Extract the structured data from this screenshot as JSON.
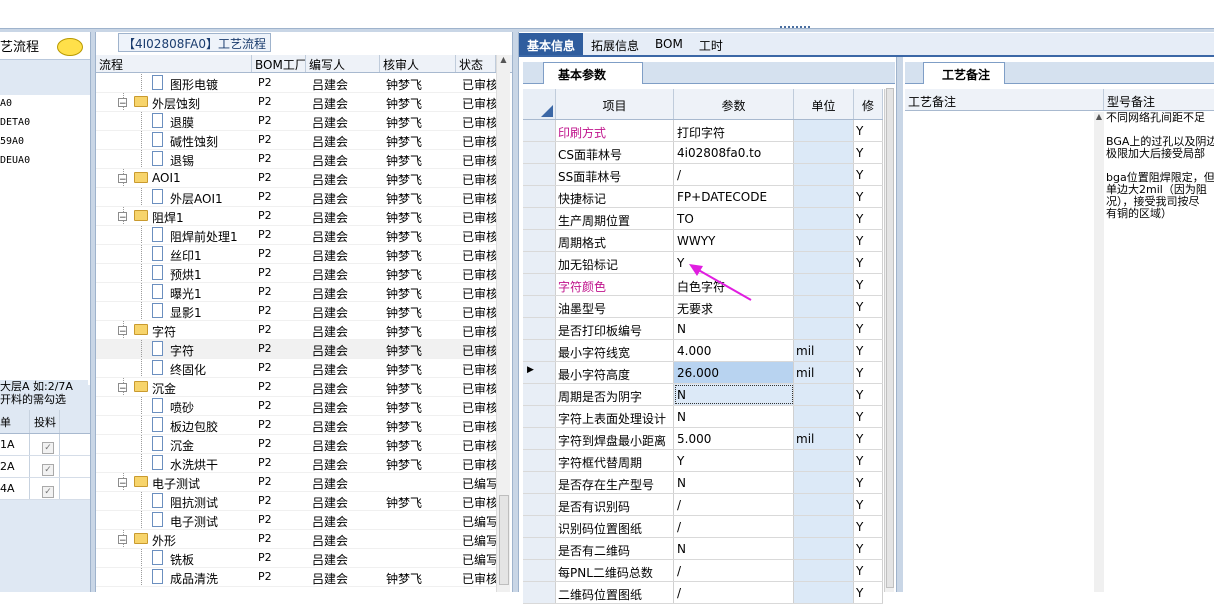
{
  "left_panel": {
    "title": "艺流程",
    "items": [
      "A0",
      "DETA0",
      "59A0",
      "DEUA0"
    ],
    "note_line1": "大层A 如:2/7A",
    "note_line2": "开料的需勾选",
    "grid_headers": [
      "单",
      "投料"
    ],
    "grid_rows": [
      {
        "name": "1A",
        "checked": true
      },
      {
        "name": "2A",
        "checked": true
      },
      {
        "name": "4A",
        "checked": true
      }
    ]
  },
  "middle": {
    "title": "【4I02808FA0】工艺流程",
    "headers": [
      "流程",
      "BOM工厂",
      "编写人",
      "核审人",
      "状态"
    ],
    "rows": [
      {
        "indent": 2,
        "type": "doc",
        "name": "图形电镀",
        "bom": "P2",
        "writer": "吕建会",
        "reviewer": "钟梦飞",
        "status": "已审核"
      },
      {
        "indent": 1,
        "type": "folder",
        "name": "外层蚀刻",
        "bom": "P2",
        "writer": "吕建会",
        "reviewer": "钟梦飞",
        "status": "已审核"
      },
      {
        "indent": 2,
        "type": "doc",
        "name": "退膜",
        "bom": "P2",
        "writer": "吕建会",
        "reviewer": "钟梦飞",
        "status": "已审核"
      },
      {
        "indent": 2,
        "type": "doc",
        "name": "碱性蚀刻",
        "bom": "P2",
        "writer": "吕建会",
        "reviewer": "钟梦飞",
        "status": "已审核"
      },
      {
        "indent": 2,
        "type": "doc",
        "name": "退锡",
        "bom": "P2",
        "writer": "吕建会",
        "reviewer": "钟梦飞",
        "status": "已审核"
      },
      {
        "indent": 1,
        "type": "folder",
        "name": "AOI1",
        "bom": "P2",
        "writer": "吕建会",
        "reviewer": "钟梦飞",
        "status": "已审核"
      },
      {
        "indent": 2,
        "type": "doc",
        "name": "外层AOI1",
        "bom": "P2",
        "writer": "吕建会",
        "reviewer": "钟梦飞",
        "status": "已审核"
      },
      {
        "indent": 1,
        "type": "folder",
        "name": "阻焊1",
        "bom": "P2",
        "writer": "吕建会",
        "reviewer": "钟梦飞",
        "status": "已审核"
      },
      {
        "indent": 2,
        "type": "doc",
        "name": "阻焊前处理1",
        "bom": "P2",
        "writer": "吕建会",
        "reviewer": "钟梦飞",
        "status": "已审核"
      },
      {
        "indent": 2,
        "type": "doc",
        "name": "丝印1",
        "bom": "P2",
        "writer": "吕建会",
        "reviewer": "钟梦飞",
        "status": "已审核"
      },
      {
        "indent": 2,
        "type": "doc",
        "name": "预烘1",
        "bom": "P2",
        "writer": "吕建会",
        "reviewer": "钟梦飞",
        "status": "已审核"
      },
      {
        "indent": 2,
        "type": "doc",
        "name": "曝光1",
        "bom": "P2",
        "writer": "吕建会",
        "reviewer": "钟梦飞",
        "status": "已审核"
      },
      {
        "indent": 2,
        "type": "doc",
        "name": "显影1",
        "bom": "P2",
        "writer": "吕建会",
        "reviewer": "钟梦飞",
        "status": "已审核"
      },
      {
        "indent": 1,
        "type": "folder",
        "name": "字符",
        "bom": "P2",
        "writer": "吕建会",
        "reviewer": "钟梦飞",
        "status": "已审核"
      },
      {
        "indent": 2,
        "type": "doc",
        "name": "字符",
        "bom": "P2",
        "writer": "吕建会",
        "reviewer": "钟梦飞",
        "status": "已审核",
        "selected": true
      },
      {
        "indent": 2,
        "type": "doc",
        "name": "终固化",
        "bom": "P2",
        "writer": "吕建会",
        "reviewer": "钟梦飞",
        "status": "已审核"
      },
      {
        "indent": 1,
        "type": "folder",
        "name": "沉金",
        "bom": "P2",
        "writer": "吕建会",
        "reviewer": "钟梦飞",
        "status": "已审核"
      },
      {
        "indent": 2,
        "type": "doc",
        "name": "喷砂",
        "bom": "P2",
        "writer": "吕建会",
        "reviewer": "钟梦飞",
        "status": "已审核"
      },
      {
        "indent": 2,
        "type": "doc",
        "name": "板边包胶",
        "bom": "P2",
        "writer": "吕建会",
        "reviewer": "钟梦飞",
        "status": "已审核"
      },
      {
        "indent": 2,
        "type": "doc",
        "name": "沉金",
        "bom": "P2",
        "writer": "吕建会",
        "reviewer": "钟梦飞",
        "status": "已审核"
      },
      {
        "indent": 2,
        "type": "doc",
        "name": "水洗烘干",
        "bom": "P2",
        "writer": "吕建会",
        "reviewer": "钟梦飞",
        "status": "已审核"
      },
      {
        "indent": 1,
        "type": "folder",
        "name": "电子测试",
        "bom": "P2",
        "writer": "吕建会",
        "reviewer": "",
        "status": "已编写"
      },
      {
        "indent": 2,
        "type": "doc",
        "name": "阻抗测试",
        "bom": "P2",
        "writer": "吕建会",
        "reviewer": "钟梦飞",
        "status": "已审核"
      },
      {
        "indent": 2,
        "type": "doc",
        "name": "电子测试",
        "bom": "P2",
        "writer": "吕建会",
        "reviewer": "",
        "status": "已编写"
      },
      {
        "indent": 1,
        "type": "folder",
        "name": "外形",
        "bom": "P2",
        "writer": "吕建会",
        "reviewer": "",
        "status": "已编写"
      },
      {
        "indent": 2,
        "type": "doc",
        "name": "铣板",
        "bom": "P2",
        "writer": "吕建会",
        "reviewer": "",
        "status": "已编写"
      },
      {
        "indent": 2,
        "type": "doc",
        "name": "成品清洗",
        "bom": "P2",
        "writer": "吕建会",
        "reviewer": "钟梦飞",
        "status": "已审核"
      }
    ]
  },
  "right": {
    "tabs": [
      "基本信息",
      "拓展信息",
      "BOM",
      "工时"
    ],
    "active_tab": "基本信息",
    "subtab_left": "基本参数",
    "subtab_right": "工艺备注",
    "param_headers": [
      "项目",
      "参数",
      "单位",
      "修"
    ],
    "params": [
      {
        "item": "印刷方式",
        "value": "打印字符",
        "unit": "",
        "flag": "Y",
        "magenta": true
      },
      {
        "item": "CS面菲林号",
        "value": "4i02808fa0.to",
        "unit": "",
        "flag": "Y"
      },
      {
        "item": "SS面菲林号",
        "value": "/",
        "unit": "",
        "flag": "Y"
      },
      {
        "item": "快捷标记",
        "value": "FP+DATECODE",
        "unit": "",
        "flag": "Y"
      },
      {
        "item": "生产周期位置",
        "value": "TO",
        "unit": "",
        "flag": "Y"
      },
      {
        "item": "周期格式",
        "value": "WWYY",
        "unit": "",
        "flag": "Y"
      },
      {
        "item": "加无铅标记",
        "value": "Y",
        "unit": "",
        "flag": "Y"
      },
      {
        "item": "字符颜色",
        "value": "白色字符",
        "unit": "",
        "flag": "Y",
        "magenta": true
      },
      {
        "item": "油墨型号",
        "value": "无要求",
        "unit": "",
        "flag": "Y"
      },
      {
        "item": "是否打印板编号",
        "value": "N",
        "unit": "",
        "flag": "Y"
      },
      {
        "item": "最小字符线宽",
        "value": "4.000",
        "unit": "mil",
        "flag": "Y"
      },
      {
        "item": "最小字符高度",
        "value": "26.000",
        "unit": "mil",
        "flag": "Y",
        "current": true
      },
      {
        "item": "周期是否为阴字",
        "value": "N",
        "unit": "",
        "flag": "Y",
        "focus": true
      },
      {
        "item": "字符上表面处理设计",
        "value": "N",
        "unit": "",
        "flag": "Y"
      },
      {
        "item": "字符到焊盘最小距离",
        "value": "5.000",
        "unit": "mil",
        "flag": "Y"
      },
      {
        "item": "字符框代替周期",
        "value": "Y",
        "unit": "",
        "flag": "Y"
      },
      {
        "item": "是否存在生产型号",
        "value": "N",
        "unit": "",
        "flag": "Y"
      },
      {
        "item": "是否有识别码",
        "value": "/",
        "unit": "",
        "flag": "Y"
      },
      {
        "item": "识别码位置图纸",
        "value": "/",
        "unit": "",
        "flag": "Y"
      },
      {
        "item": "是否有二维码",
        "value": "N",
        "unit": "",
        "flag": "Y"
      },
      {
        "item": "每PNL二维码总数",
        "value": "/",
        "unit": "",
        "flag": "Y"
      },
      {
        "item": "二维码位置图纸",
        "value": "/",
        "unit": "",
        "flag": "Y"
      }
    ],
    "notes_headers": [
      "工艺备注",
      "型号备注"
    ],
    "model_notes": [
      "不同网络孔间距不足",
      "",
      "BGA上的过孔以及阴边",
      "极限加大后接受局部",
      "",
      "bga位置阻焊限定，但",
      "单边大2mil（因为阻",
      "况），接受我司按尽",
      "有铜的区域）"
    ]
  },
  "colors": {
    "accent": "#2f5d9e",
    "magenta": "#c0148c",
    "highlight": "#b8d3f0"
  }
}
